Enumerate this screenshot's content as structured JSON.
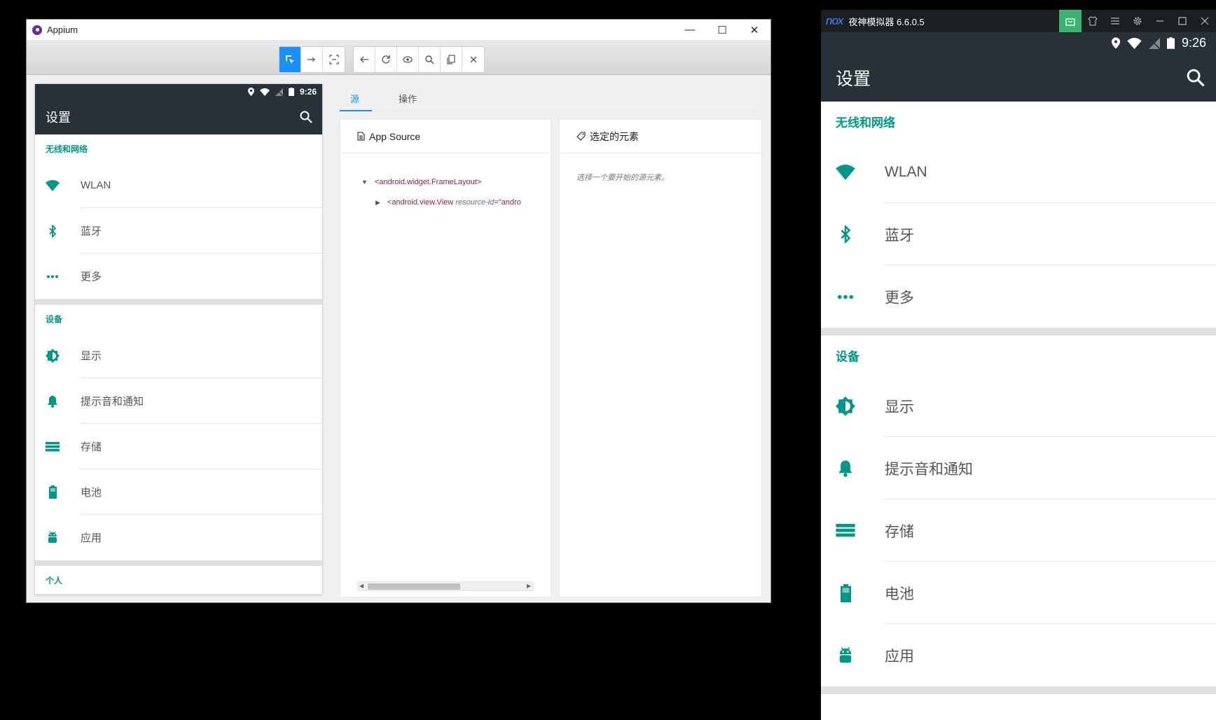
{
  "appium": {
    "title": "Appium",
    "win_min": "—",
    "win_max": "☐",
    "win_close": "✕",
    "tabs": {
      "source": "源",
      "actions": "操作"
    },
    "source_card": {
      "title": "App Source",
      "tree": [
        {
          "tag": "<android.widget.FrameLayout>"
        },
        {
          "tag": "<android.view.View ",
          "attr": "resource-id",
          "eq": "=\"andro"
        }
      ]
    },
    "selected_card": {
      "title": "选定的元素",
      "placeholder": "选择一个要开始的源元素。"
    }
  },
  "device": {
    "time": "9:26",
    "title": "设置",
    "sections": [
      {
        "title": "无线和网络",
        "items": [
          {
            "label": "WLAN",
            "icon": "wifi-icon"
          },
          {
            "label": "蓝牙",
            "icon": "bluetooth-icon"
          },
          {
            "label": "更多",
            "icon": "more-icon"
          }
        ]
      },
      {
        "title": "设备",
        "items": [
          {
            "label": "显示",
            "icon": "brightness-icon"
          },
          {
            "label": "提示音和通知",
            "icon": "bell-icon"
          },
          {
            "label": "存储",
            "icon": "storage-icon"
          },
          {
            "label": "电池",
            "icon": "battery-icon"
          },
          {
            "label": "应用",
            "icon": "android-icon"
          }
        ]
      },
      {
        "title": "个人",
        "items": []
      }
    ]
  },
  "nox": {
    "logo": "nox",
    "title": "夜神模拟器 6.6.0.5"
  },
  "colors": {
    "accent": "#009688",
    "actionbar": "#263238",
    "appium_blue": "#1890ff"
  }
}
